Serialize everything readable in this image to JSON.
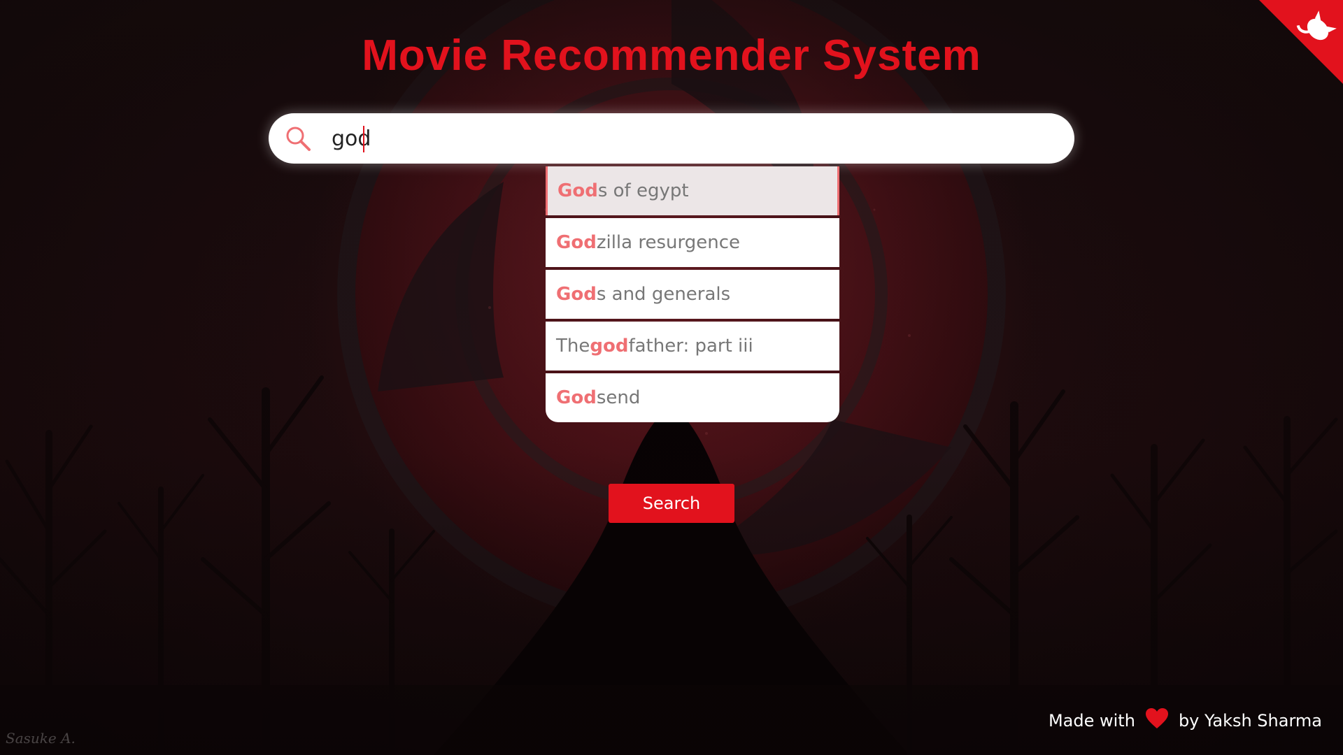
{
  "page": {
    "title": "Movie Recommender System"
  },
  "search": {
    "value": "god",
    "icon": "search-icon"
  },
  "suggestions": [
    {
      "before": "",
      "match": "God",
      "after": "s of egypt",
      "active": true
    },
    {
      "before": "",
      "match": "God",
      "after": "zilla resurgence",
      "active": false
    },
    {
      "before": "",
      "match": "God",
      "after": "s and generals",
      "active": false
    },
    {
      "before": "The ",
      "match": "god",
      "after": "father: part iii",
      "active": false
    },
    {
      "before": "",
      "match": "God",
      "after": "send",
      "active": false
    }
  ],
  "button": {
    "label": "Search"
  },
  "footer": {
    "prefix": "Made with",
    "suffix": "by Yaksh Sharma",
    "icon": "heart-icon"
  },
  "signature": "Sasuke A.",
  "colors": {
    "accent": "#e2121d",
    "highlight": "#ef6f73",
    "background": "#140a0b",
    "suggestion_text": "#777777"
  }
}
